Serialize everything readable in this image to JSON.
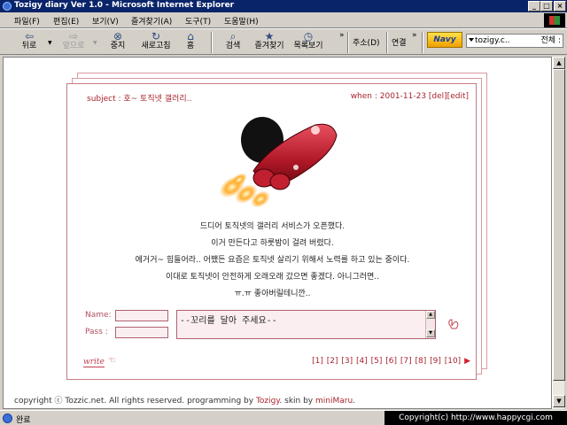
{
  "window": {
    "title": "Tozigy diary Ver 1.0 - Microsoft Internet Explorer",
    "min": "_",
    "max": "□",
    "close": "×"
  },
  "menu": [
    "파일(F)",
    "편집(E)",
    "보기(V)",
    "즐겨찾기(A)",
    "도구(T)",
    "도움말(H)"
  ],
  "toolbar": {
    "back": "뒤로",
    "forward": "앞으로",
    "stop": "중지",
    "refresh": "새로고침",
    "home": "홈",
    "search": "검색",
    "favorites": "즐겨찾기",
    "history": "목록보기",
    "more": "»",
    "address": "주소(D)",
    "links": "연결",
    "more2": "»"
  },
  "addon": {
    "logo": "Navy",
    "search_value": "tozigy.c..",
    "scope": "전체 :"
  },
  "post": {
    "subject": "subject : 호~ 토직넷 갤러리..",
    "when": "when : 2001-11-23 [del][edit]",
    "lines": [
      "드디어 토직넷의 갤러리 서비스가 오픈했다.",
      "이거 만든다고 하룻밤이 걸려 버렸다.",
      "에거거~ 힘들어라.. 어쨌든 요즘은 토직넷 살리기 위해서 노력를 하고 있는 중이다.",
      "이대로 토직넷이 안전하게 오래오래 갔으면 좋겠다. 아니그러면..",
      "ㅠ.ㅠ 좋아버릴테니깐.."
    ]
  },
  "comment_form": {
    "name_label": "Name:",
    "pass_label": "Pass :",
    "placeholder": "--꼬리를 달아 주세요--"
  },
  "write_label": "write",
  "pager": {
    "pages": [
      "[1]",
      "[2]",
      "[3]",
      "[4]",
      "[5]",
      "[6]",
      "[7]",
      "[8]",
      "[9]",
      "[10]"
    ],
    "next": "▶"
  },
  "footer": {
    "prefix": "copyright ⓒ Tozzic.net. All rights reserved. programming by ",
    "author": "Tozigy",
    "mid": ". skin by ",
    "skin": "miniMaru",
    "end": "."
  },
  "status": {
    "text": "완료",
    "watermark": "Copyright(c) http://www.happycgi.com"
  }
}
